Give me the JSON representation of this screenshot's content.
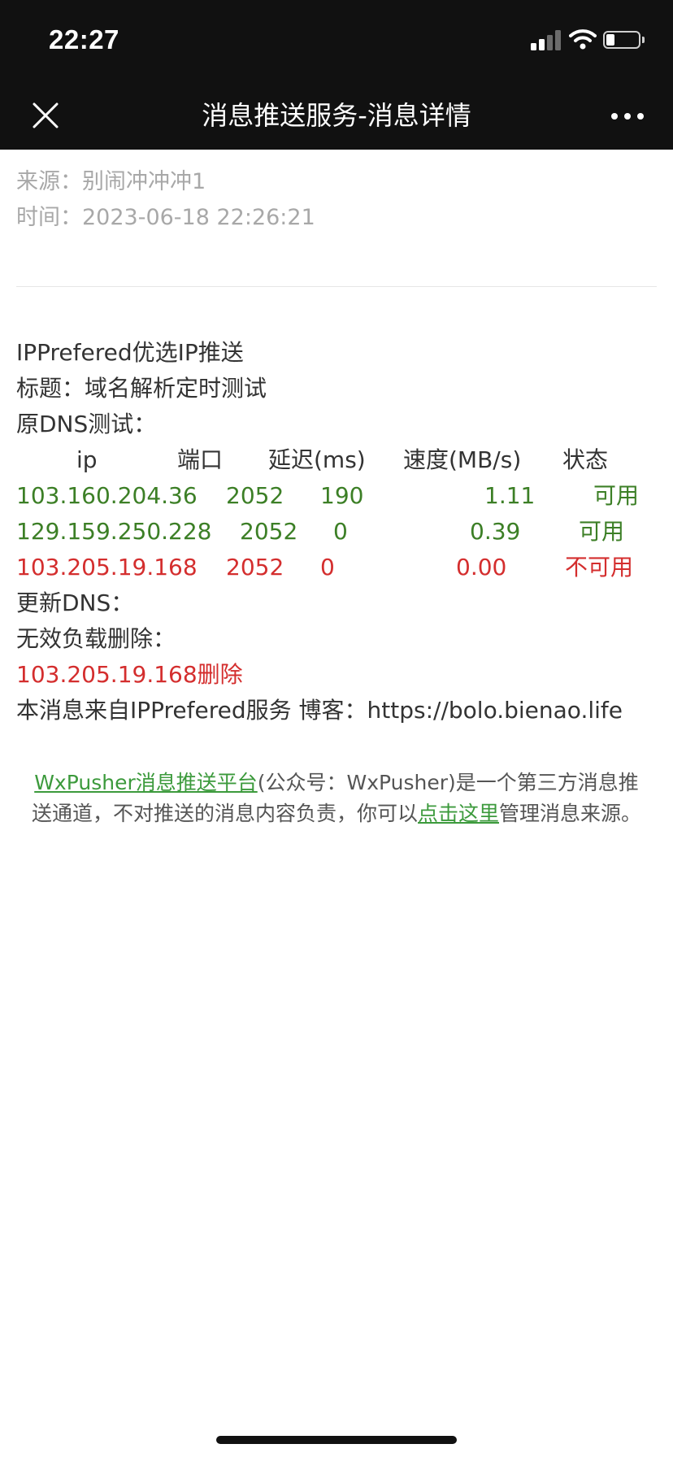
{
  "status_bar": {
    "time": "22:27",
    "signal_icon": "cellular-signal-icon",
    "wifi_icon": "wifi-icon",
    "battery_icon": "battery-icon",
    "battery_level": 0.25
  },
  "nav": {
    "title": "消息推送服务-消息详情",
    "close_icon": "close-icon",
    "more_icon": "more-dots-icon"
  },
  "meta": {
    "source_label": "来源：",
    "source_value": "别闹冲冲冲1",
    "time_label": "时间：",
    "time_value": "2023-06-18 22:26:21"
  },
  "message": {
    "heading": "IPPrefered优选IP推送",
    "title_line": "标题：域名解析定时测试",
    "dns_test_label": "原DNS测试：",
    "table_headers": [
      "ip",
      "端口",
      "延迟(ms)",
      "速度(MB/s)",
      "状态"
    ],
    "rows": [
      {
        "ip": "103.160.204.36",
        "port": "2052",
        "latency": "190",
        "speed": "1.11",
        "status": "可用",
        "ok": true
      },
      {
        "ip": "129.159.250.228",
        "port": "2052",
        "latency": "0",
        "speed": "0.39",
        "status": "可用",
        "ok": true
      },
      {
        "ip": "103.205.19.168",
        "port": "2052",
        "latency": "0",
        "speed": "0.00",
        "status": "不可用",
        "ok": false
      }
    ],
    "update_dns_label": "更新DNS：",
    "invalid_delete_label": "无效负载删除：",
    "deleted_line": "103.205.19.168删除",
    "source_line": "本消息来自IPPrefered服务 博客：https://bolo.bienao.life"
  },
  "footer": {
    "platform_link": "WxPusher消息推送平台",
    "text_1": "(公众号：WxPusher)是一个第三方消息推送通道，不对推送的消息内容负责，你可以",
    "manage_link": "点击这里",
    "text_2": "管理消息来源。"
  },
  "colors": {
    "ok": "#3c7f26",
    "error": "#d42e2e",
    "link": "#3c9a3c",
    "bar": "#111111"
  }
}
